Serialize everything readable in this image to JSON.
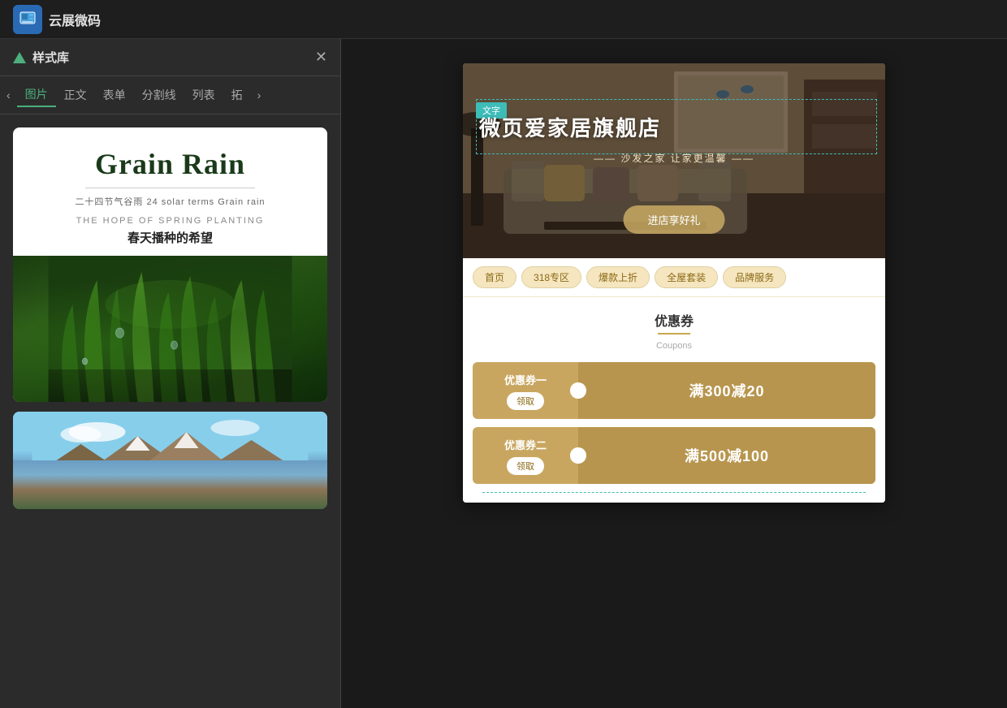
{
  "topbar": {
    "logo_text": "云展微码",
    "logo_icon": "🖼"
  },
  "left_panel": {
    "title": "样式库",
    "close_icon": "✕",
    "tabs": [
      {
        "label": "图片",
        "active": true
      },
      {
        "label": "正文",
        "active": false
      },
      {
        "label": "表单",
        "active": false
      },
      {
        "label": "分割线",
        "active": false
      },
      {
        "label": "列表",
        "active": false
      },
      {
        "label": "拓",
        "active": false
      }
    ],
    "card1": {
      "title": "Grain Rain",
      "subtitle": "二十四节气谷雨 24  solar terms Grain rain",
      "sub_en": "THE HOPE OF SPRING PLANTING",
      "sub_cn": "春天播种的希望"
    },
    "card2": {
      "type": "mountain_lake"
    }
  },
  "right_panel": {
    "hero": {
      "badge": "文字",
      "title": "微页爱家居旗舰店",
      "subtitle": "—— 沙发之家 让家更温馨 ——",
      "button": "进店享好礼"
    },
    "nav_tabs": [
      {
        "label": "首页"
      },
      {
        "label": "318专区"
      },
      {
        "label": "爆款上折"
      },
      {
        "label": "全屋套装"
      },
      {
        "label": "品牌服务"
      }
    ],
    "coupons": {
      "title": "优惠券",
      "subtitle": "Coupons",
      "items": [
        {
          "name": "优惠券一",
          "get_label": "领取",
          "amount": "满300减20"
        },
        {
          "name": "优惠券二",
          "get_label": "领取",
          "amount": "满500减100"
        }
      ]
    }
  },
  "colors": {
    "accent_green": "#4caf7d",
    "accent_teal": "#3dbcb8",
    "accent_gold": "#c9a660",
    "accent_gold_dark": "#b8954e",
    "text_gold": "#8b6914"
  }
}
